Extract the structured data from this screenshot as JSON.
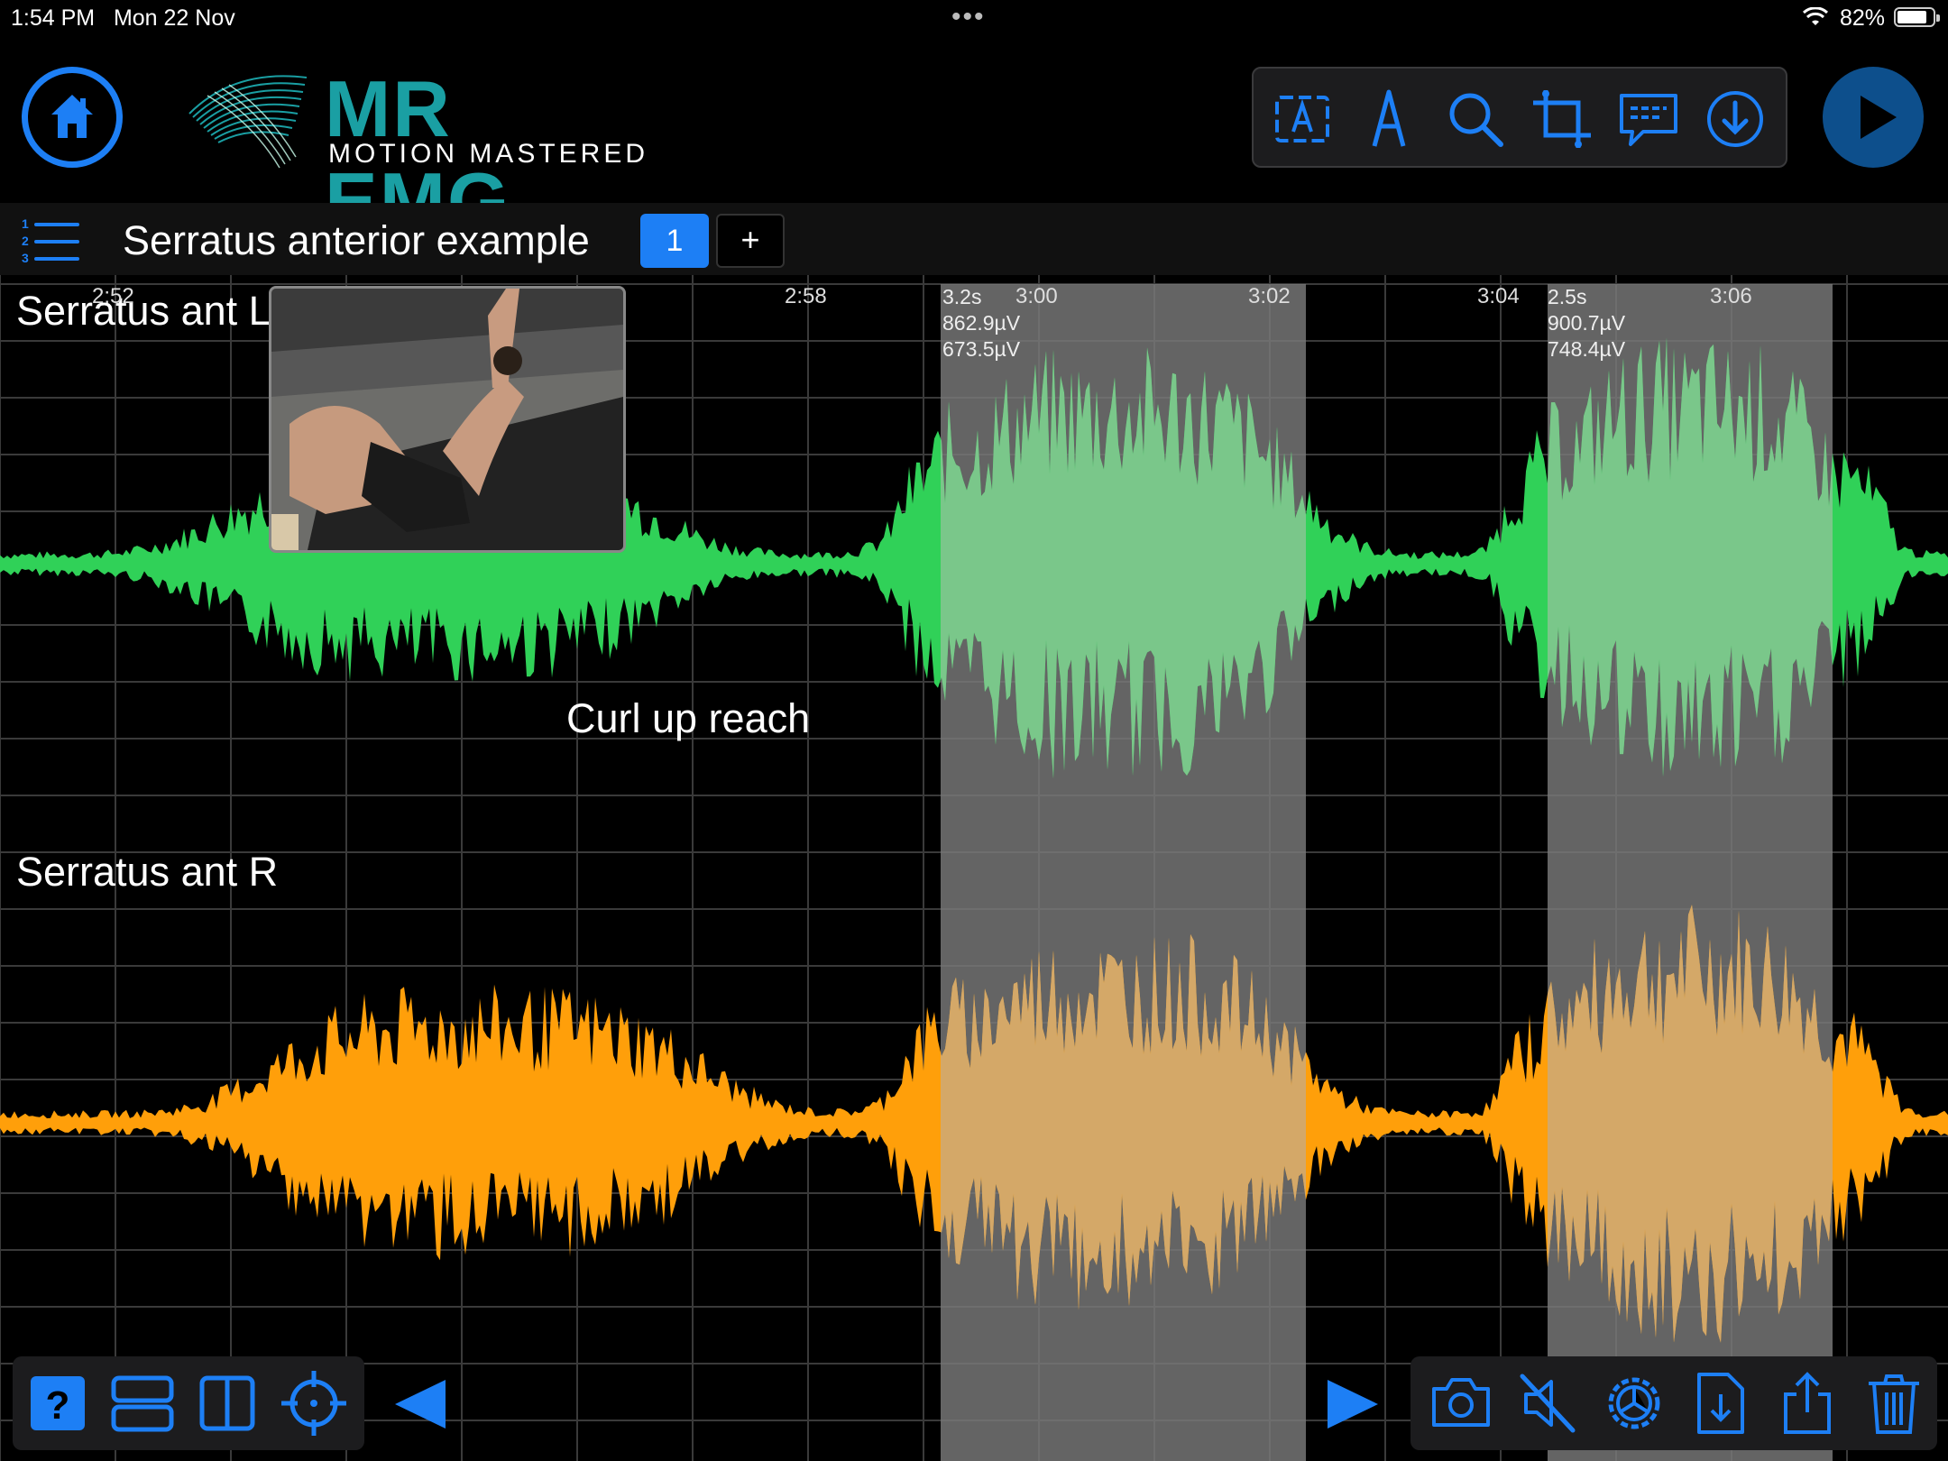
{
  "status": {
    "time": "1:54 PM",
    "date": "Mon 22 Nov",
    "more": "•••",
    "battery": "82%"
  },
  "brand": {
    "name": "MR EMG",
    "tagline": "MOTION MASTERED",
    "color": "#1a9fa3"
  },
  "accent": "#1d7ff5",
  "toolbar": {
    "icons": [
      "text-box-icon",
      "pen-icon",
      "search-icon",
      "crop-icon",
      "comment-icon",
      "download-icon"
    ]
  },
  "session": {
    "title": "Serratus anterior example",
    "page": "1",
    "add": "+"
  },
  "channels": [
    {
      "name": "Serratus ant L",
      "color": "#30d158"
    },
    {
      "name": "Serratus ant R",
      "color": "#ff9f0a"
    }
  ],
  "time_ticks": [
    "2:52",
    "2:58",
    "3:00",
    "3:02",
    "3:04",
    "3:06"
  ],
  "selections": [
    {
      "duration": "3.2s",
      "peak": "862.9µV",
      "mean": "673.5µV"
    },
    {
      "duration": "2.5s",
      "peak": "900.7µV",
      "mean": "748.4µV"
    }
  ],
  "annotation": "Curl up reach",
  "bottom_left": [
    "help-icon",
    "stacked-layout-icon",
    "split-layout-icon",
    "crosshair-icon"
  ],
  "bottom_right": [
    "camera-icon",
    "mute-icon",
    "settings-gear-icon",
    "export-file-icon",
    "share-icon",
    "trash-icon"
  ]
}
